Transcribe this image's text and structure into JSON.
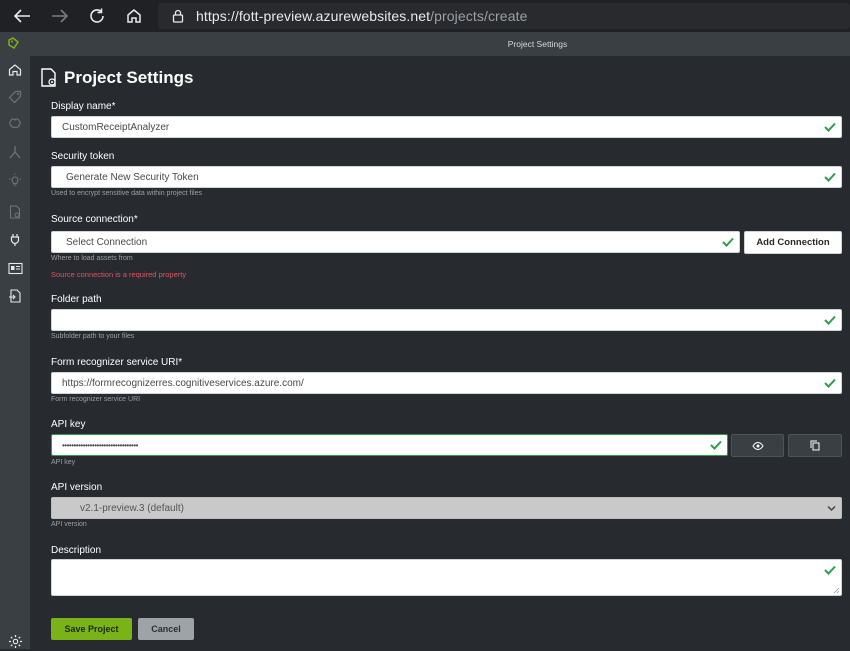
{
  "browser": {
    "url_host": "https://fott-preview.azurewebsites.net",
    "url_path": "/projects/create"
  },
  "window": {
    "title": "Project Settings"
  },
  "page": {
    "title": "Project Settings"
  },
  "form": {
    "display_name": {
      "label": "Display name*",
      "value": "CustomReceiptAnalyzer"
    },
    "security_token": {
      "label": "Security token",
      "value": "Generate New Security Token",
      "help": "Used to encrypt sensitive data within project files"
    },
    "source_connection": {
      "label": "Source connection*",
      "value": "Select Connection",
      "help": "Where to load assets from",
      "error": "Source connection is a required property",
      "add_label": "Add Connection"
    },
    "folder_path": {
      "label": "Folder path",
      "value": "",
      "help": "Subfolder path to your files"
    },
    "service_uri": {
      "label": "Form recognizer service URI*",
      "value": "https://formrecognizerres.cognitiveservices.azure.com/",
      "help": "Form recognizer service URI"
    },
    "api_key": {
      "label": "API key",
      "value": "•••••••••••••••••••••••••••••••••",
      "help": "API key"
    },
    "api_version": {
      "label": "API version",
      "value": "v2.1-preview.3 (default)",
      "help": "API version"
    },
    "description": {
      "label": "Description",
      "value": ""
    }
  },
  "actions": {
    "save_label": "Save Project",
    "cancel_label": "Cancel"
  },
  "colors": {
    "accent": "#7ab317",
    "valid": "#2e9e4a",
    "error": "#e0555a",
    "background": "#272b30",
    "sidebar": "#3a3f44"
  }
}
